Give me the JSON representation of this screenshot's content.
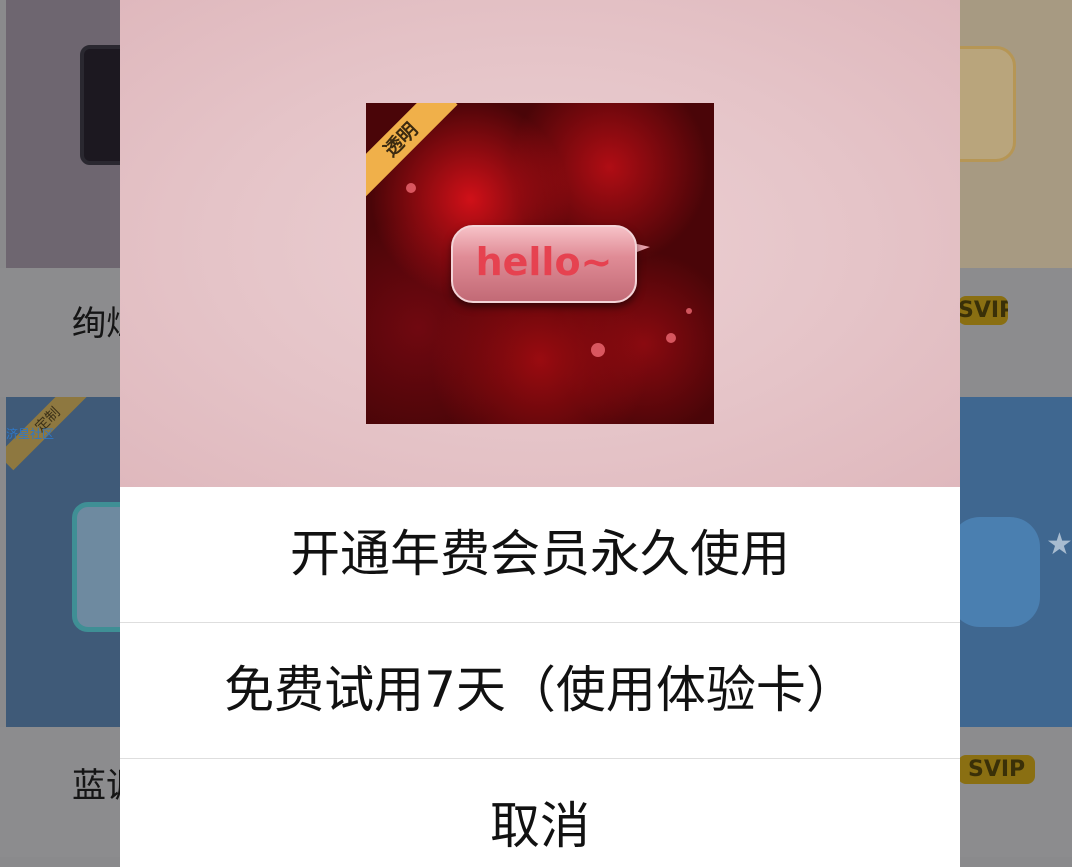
{
  "background": {
    "items": [
      {
        "title": "绚烂",
        "badge": "SVIP",
        "ribbon": ""
      },
      {
        "title": "蓝调",
        "badge": "SVIP",
        "ribbon": "定制",
        "caption": "济星社区"
      }
    ]
  },
  "modal": {
    "preview": {
      "tag": "透明",
      "bubble_text": "hello~"
    },
    "options": [
      {
        "label": "开通年费会员永久使用"
      },
      {
        "label": "免费试用7天（使用体验卡）"
      },
      {
        "label": "取消"
      }
    ]
  },
  "colors": {
    "overlay": "#8a8a8c",
    "modal_bg": "#ffffff",
    "preview_bg": "#e5c4c8",
    "tag_bg": "#f0b04a",
    "bubble_text": "#e64250"
  }
}
